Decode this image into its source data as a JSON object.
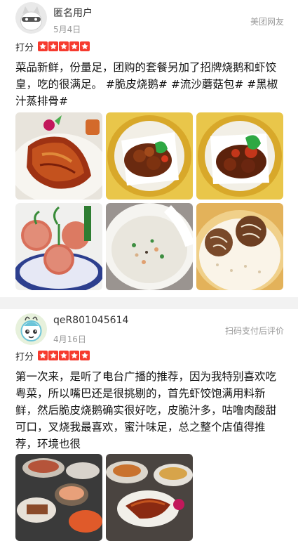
{
  "reviews": [
    {
      "username": "匿名用户",
      "date": "5月4日",
      "source": "美团网友",
      "rating_label": "打分",
      "stars": 5,
      "content": "菜品新鲜，份量足，团购的套餐另加了招牌烧鹅和虾饺皇，吃的很满足。 #脆皮烧鹅# #流沙蘑菇包# #黑椒汁蒸排骨#",
      "avatar_icon": "anonymous-avatar-icon"
    },
    {
      "username": "qeR801045614",
      "date": "4月16日",
      "source": "扫码支付后评价",
      "rating_label": "打分",
      "stars": 5,
      "content": "第一次来，是听了电台广播的推荐，因为我特别喜欢吃粤菜，所以嘴巴还是很挑剔的，首先虾饺饱满用料新鲜，然后脆皮烧鹅确实很好吃，皮脆汁多，咕噜肉酸甜可口，叉烧我最喜欢，蜜汁味足，总之整个店值得推荐，环境也很",
      "avatar_icon": "cartoon-avatar-icon"
    }
  ],
  "colors": {
    "star_red": "#f63a2e",
    "divider": "#f2f2f2",
    "meta_gray": "#999999"
  }
}
